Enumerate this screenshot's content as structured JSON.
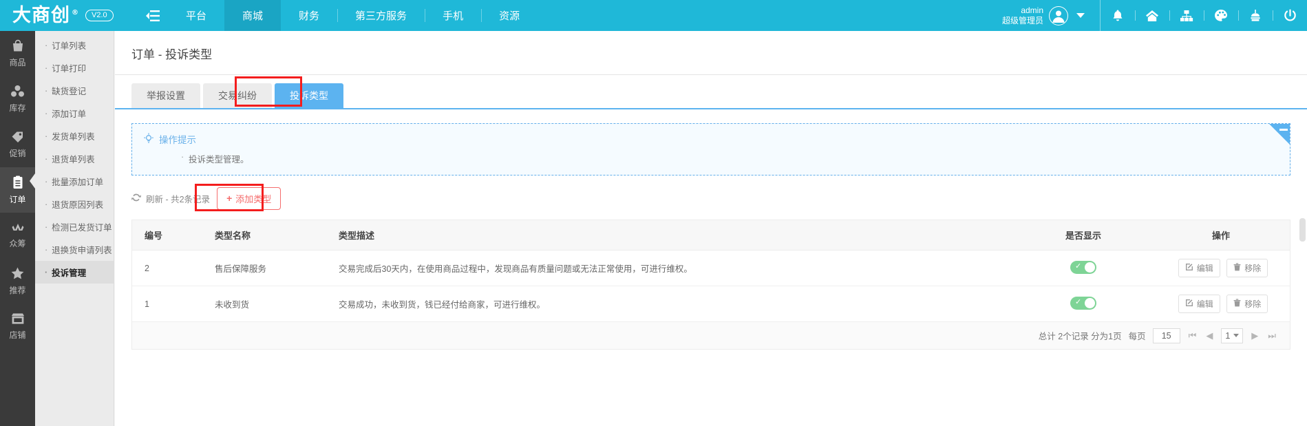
{
  "header": {
    "logo_text": "大商创",
    "logo_reg": "®",
    "version": "V2.0",
    "collapse_icon": "collapse-menu-icon",
    "nav": [
      {
        "label": "平台",
        "active": false
      },
      {
        "label": "商城",
        "active": true
      },
      {
        "label": "财务",
        "active": false
      },
      {
        "label": "第三方服务",
        "active": false
      },
      {
        "label": "手机",
        "active": false
      },
      {
        "label": "资源",
        "active": false
      }
    ],
    "user": {
      "login": "admin",
      "role": "超级管理员"
    },
    "icons": [
      "bell-icon",
      "home-icon",
      "sitemap-icon",
      "palette-icon",
      "broom-icon",
      "power-icon"
    ]
  },
  "sidebar": {
    "modules": [
      {
        "label": "商品",
        "icon": "bag-icon",
        "active": false
      },
      {
        "label": "库存",
        "icon": "boxes-icon",
        "active": false
      },
      {
        "label": "促销",
        "icon": "tags-icon",
        "active": false
      },
      {
        "label": "订单",
        "icon": "clipboard-icon",
        "active": true
      },
      {
        "label": "众筹",
        "icon": "crowd-icon",
        "active": false
      },
      {
        "label": "推荐",
        "icon": "star-icon",
        "active": false
      },
      {
        "label": "店铺",
        "icon": "shop-icon",
        "active": false
      }
    ],
    "items": [
      {
        "label": "订单列表",
        "active": false
      },
      {
        "label": "订单打印",
        "active": false
      },
      {
        "label": "缺货登记",
        "active": false
      },
      {
        "label": "添加订单",
        "active": false
      },
      {
        "label": "发货单列表",
        "active": false
      },
      {
        "label": "退货单列表",
        "active": false
      },
      {
        "label": "批量添加订单",
        "active": false
      },
      {
        "label": "退货原因列表",
        "active": false
      },
      {
        "label": "检测已发货订单",
        "active": false
      },
      {
        "label": "退换货申请列表",
        "active": false
      },
      {
        "label": "投诉管理",
        "active": true
      }
    ]
  },
  "main": {
    "title": "订单 - 投诉类型",
    "tabs": [
      {
        "label": "举报设置",
        "active": false
      },
      {
        "label": "交易纠纷",
        "active": false
      },
      {
        "label": "投诉类型",
        "active": true
      }
    ],
    "tip": {
      "icon": "lightbulb-icon",
      "title": "操作提示",
      "items": [
        "投诉类型管理。"
      ],
      "collapse_icon": "collapse-ribbon-icon"
    },
    "toolbar": {
      "refresh_icon": "refresh-icon",
      "refresh_label": "刷新 - 共2条记录",
      "add_icon": "plus-icon",
      "add_label": "添加类型"
    },
    "table": {
      "columns": [
        "编号",
        "类型名称",
        "类型描述",
        "是否显示",
        "操作"
      ],
      "rows": [
        {
          "id": "2",
          "name": "售后保障服务",
          "desc": "交易完成后30天内，在使用商品过程中，发现商品有质量问题或无法正常使用，可进行维权。",
          "show": true,
          "edit_label": "编辑",
          "remove_label": "移除"
        },
        {
          "id": "1",
          "name": "未收到货",
          "desc": "交易成功，未收到货，钱已经付给商家，可进行维权。",
          "show": true,
          "edit_label": "编辑",
          "remove_label": "移除"
        }
      ]
    },
    "pager": {
      "summary": "总计 2个记录 分为1页",
      "per_page_label": "每页",
      "per_page_value": "15",
      "first_icon": "first-page-icon",
      "prev_icon": "prev-page-icon",
      "current_page": "1",
      "next_icon": "next-page-icon",
      "last_icon": "last-page-icon"
    }
  },
  "colors": {
    "brand": "#1fb8d8",
    "tab_active": "#5cb3f0",
    "highlight": "#f41d1d",
    "danger": "#f56c6c",
    "toggle_on": "#7ed496"
  }
}
